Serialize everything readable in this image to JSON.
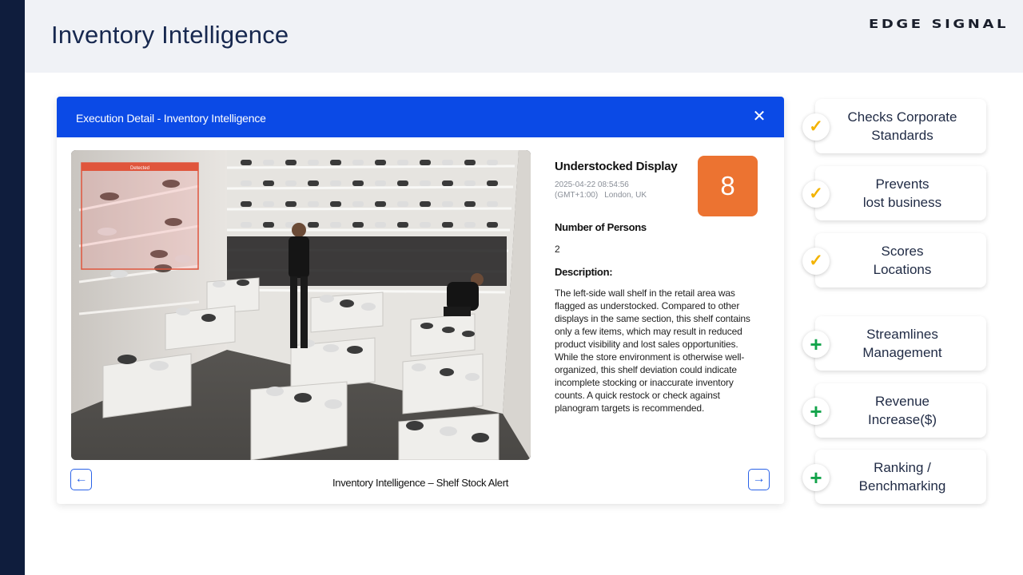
{
  "header": {
    "title": "Inventory Intelligence",
    "brand": "EDGE SIGNAL"
  },
  "modal": {
    "title": "Execution Detail - Inventory Intelligence",
    "close_icon": "close-icon",
    "detection_label": "Detected",
    "alert_title": "Understocked Display",
    "timestamp": "2025-04-22 08:54:56",
    "timezone": "(GMT+1:00)",
    "location": "London, UK",
    "score": "8",
    "persons_label": "Number of Persons",
    "persons_value": "2",
    "description_label": "Description:",
    "description": "The left-side wall shelf in the retail area was flagged as understocked. Compared to other displays in the same section, this shelf contains only a few items, which may result in reduced product visibility and lost sales opportunities. While the store environment is otherwise well-organized, this shelf deviation could indicate incomplete stocking or inaccurate inventory counts. A quick restock or check against planogram targets is recommended.",
    "caption": "Inventory Intelligence – Shelf Stock Alert",
    "prev_icon": "arrow-left-icon",
    "next_icon": "arrow-right-icon"
  },
  "features": [
    {
      "line1": "Checks Corporate",
      "line2": "Standards",
      "icon": "check-icon"
    },
    {
      "line1": "Prevents",
      "line2": "lost business",
      "icon": "check-icon"
    },
    {
      "line1": "Scores",
      "line2": "Locations",
      "icon": "check-icon"
    },
    {
      "line1": "Streamlines",
      "line2": "Management",
      "icon": "plus-icon"
    },
    {
      "line1": "Revenue",
      "line2": "Increase($)",
      "icon": "plus-icon"
    },
    {
      "line1": "Ranking /",
      "line2": "Benchmarking",
      "icon": "plus-icon"
    }
  ],
  "colors": {
    "accent_blue": "#0b4ae6",
    "score_orange": "#ec7331",
    "check_yellow": "#f3b300",
    "plus_green": "#12a34a",
    "rail_navy": "#0f1d3d"
  }
}
